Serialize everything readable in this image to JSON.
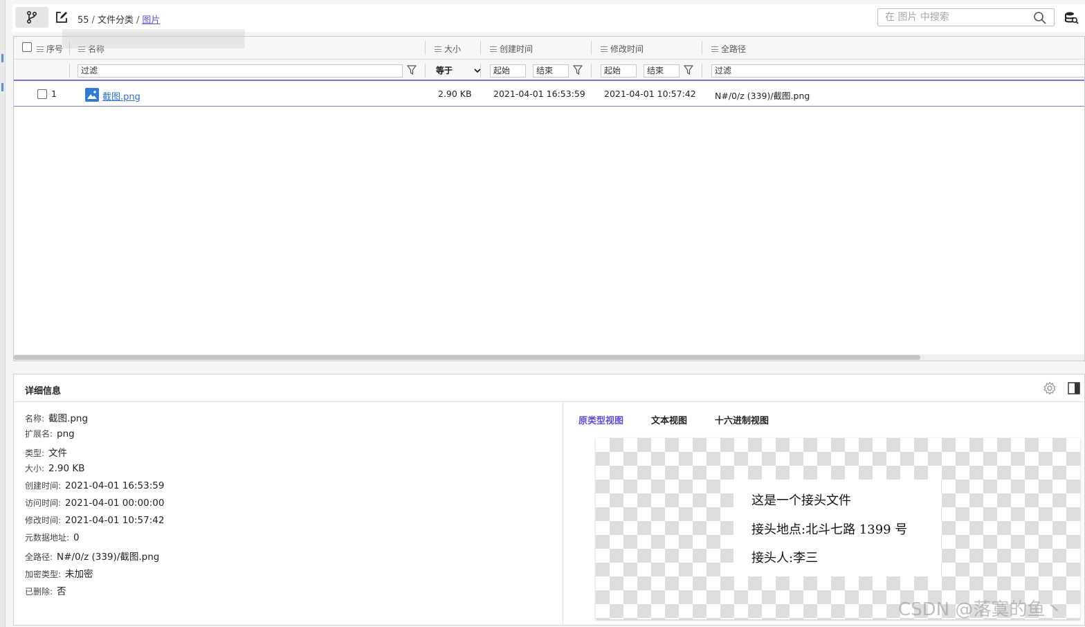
{
  "breadcrumb": {
    "root": "55",
    "sep1": "/",
    "mid": "文件分类",
    "sep2": "/",
    "current": "图片"
  },
  "search": {
    "placeholder": "在 图片 中搜索"
  },
  "table": {
    "columns": {
      "index": "序号",
      "name": "名称",
      "size": "大小",
      "created": "创建时间",
      "modified": "修改时间",
      "path": "全路径"
    },
    "filters": {
      "name": "过滤",
      "size_op": "等于",
      "created_start": "起始",
      "created_end": "结束",
      "modified_start": "起始",
      "modified_end": "结束",
      "path": "过滤"
    },
    "rows": [
      {
        "index": "1",
        "name": "截图.png",
        "size": "2.90 KB",
        "created": "2021-04-01 16:53:59",
        "modified": "2021-04-01 10:57:42",
        "path": "N#/0/z (339)/截图.png"
      }
    ]
  },
  "details": {
    "title": "详细信息",
    "props": [
      {
        "k": "名称:",
        "v": "截图.png"
      },
      {
        "k": "扩展名:",
        "v": "png"
      },
      {
        "k": "类型:",
        "v": "文件"
      },
      {
        "k": "大小:",
        "v": "2.90 KB"
      },
      {
        "k": "创建时间:",
        "v": "2021-04-01 16:53:59"
      },
      {
        "k": "访问时间:",
        "v": "2021-04-01 00:00:00"
      },
      {
        "k": "修改时间:",
        "v": "2021-04-01 10:57:42"
      },
      {
        "k": "元数据地址:",
        "v": "0"
      },
      {
        "k": "全路径:",
        "v": "N#/0/z (339)/截图.png"
      },
      {
        "k": "加密类型:",
        "v": "未加密"
      },
      {
        "k": "已删除:",
        "v": "否"
      }
    ],
    "tabs": [
      "原类型视图",
      "文本视图",
      "十六进制视图"
    ],
    "preview_lines": [
      "这是一个接头文件",
      "接头地点:北斗七路 1399 号",
      "接头人:李三"
    ]
  },
  "watermark": "CSDN @落寞的鱼丶",
  "colors": {
    "accent": "#5b4fcf",
    "link": "#2a6fc9"
  }
}
